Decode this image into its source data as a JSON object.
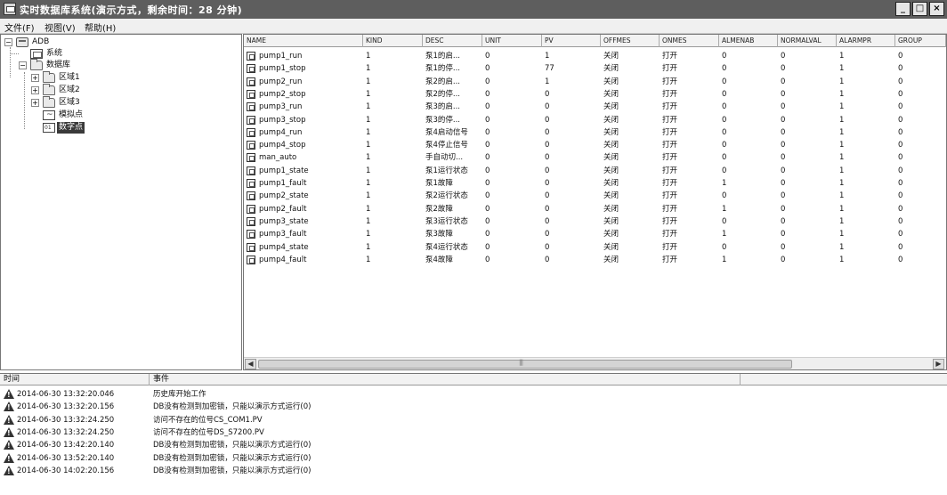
{
  "window": {
    "title": "实时数据库系统(演示方式，剩余时间：28 分钟)",
    "minimize": "_",
    "maximize": "□",
    "close": "×"
  },
  "menu": [
    {
      "label": "文件(F)"
    },
    {
      "label": "视图(V)"
    },
    {
      "label": "帮助(H)"
    }
  ],
  "tree": {
    "expand_symbol": "+",
    "collapse_symbol": "−",
    "nodes": [
      {
        "label": "ADB",
        "icon": "database-icon",
        "expander": "collapse"
      },
      {
        "label": "系统",
        "icon": "system-icon",
        "expander": null
      },
      {
        "label": "数据库",
        "icon": "folder-icon",
        "expander": "collapse"
      },
      {
        "label": "区域1",
        "icon": "folder-icon",
        "expander": "expand"
      },
      {
        "label": "区域2",
        "icon": "folder-icon",
        "expander": "expand"
      },
      {
        "label": "区域3",
        "icon": "folder-icon",
        "expander": "expand"
      },
      {
        "label": "模拟点",
        "icon": "analog-point-icon",
        "expander": null
      },
      {
        "label": "数字点",
        "icon": "digital-point-icon",
        "expander": null,
        "selected": true
      }
    ]
  },
  "grid": {
    "columns": [
      "NAME",
      "KIND",
      "DESC",
      "UNIT",
      "PV",
      "OFFMES",
      "ONMES",
      "ALMENAB",
      "NORMALVAL",
      "ALARMPR",
      "GROUP"
    ],
    "rows": [
      [
        "pump1_run",
        "1",
        "泵1的启...",
        "0",
        "1",
        "关闭",
        "打开",
        "0",
        "0",
        "1",
        "0"
      ],
      [
        "pump1_stop",
        "1",
        "泵1的停...",
        "0",
        "77",
        "关闭",
        "打开",
        "0",
        "0",
        "1",
        "0"
      ],
      [
        "pump2_run",
        "1",
        "泵2的启...",
        "0",
        "1",
        "关闭",
        "打开",
        "0",
        "0",
        "1",
        "0"
      ],
      [
        "pump2_stop",
        "1",
        "泵2的停...",
        "0",
        "0",
        "关闭",
        "打开",
        "0",
        "0",
        "1",
        "0"
      ],
      [
        "pump3_run",
        "1",
        "泵3的启...",
        "0",
        "0",
        "关闭",
        "打开",
        "0",
        "0",
        "1",
        "0"
      ],
      [
        "pump3_stop",
        "1",
        "泵3的停...",
        "0",
        "0",
        "关闭",
        "打开",
        "0",
        "0",
        "1",
        "0"
      ],
      [
        "pump4_run",
        "1",
        "泵4启动信号",
        "0",
        "0",
        "关闭",
        "打开",
        "0",
        "0",
        "1",
        "0"
      ],
      [
        "pump4_stop",
        "1",
        "泵4停止信号",
        "0",
        "0",
        "关闭",
        "打开",
        "0",
        "0",
        "1",
        "0"
      ],
      [
        "man_auto",
        "1",
        "手自动切...",
        "0",
        "0",
        "关闭",
        "打开",
        "0",
        "0",
        "1",
        "0"
      ],
      [
        "pump1_state",
        "1",
        "泵1运行状态",
        "0",
        "0",
        "关闭",
        "打开",
        "0",
        "0",
        "1",
        "0"
      ],
      [
        "pump1_fault",
        "1",
        "泵1故障",
        "0",
        "0",
        "关闭",
        "打开",
        "1",
        "0",
        "1",
        "0"
      ],
      [
        "pump2_state",
        "1",
        "泵2运行状态",
        "0",
        "0",
        "关闭",
        "打开",
        "0",
        "0",
        "1",
        "0"
      ],
      [
        "pump2_fault",
        "1",
        "泵2故障",
        "0",
        "0",
        "关闭",
        "打开",
        "1",
        "0",
        "1",
        "0"
      ],
      [
        "pump3_state",
        "1",
        "泵3运行状态",
        "0",
        "0",
        "关闭",
        "打开",
        "0",
        "0",
        "1",
        "0"
      ],
      [
        "pump3_fault",
        "1",
        "泵3故障",
        "0",
        "0",
        "关闭",
        "打开",
        "1",
        "0",
        "1",
        "0"
      ],
      [
        "pump4_state",
        "1",
        "泵4运行状态",
        "0",
        "0",
        "关闭",
        "打开",
        "0",
        "0",
        "1",
        "0"
      ],
      [
        "pump4_fault",
        "1",
        "泵4故障",
        "0",
        "0",
        "关闭",
        "打开",
        "1",
        "0",
        "1",
        "0"
      ]
    ]
  },
  "scrollbar": {
    "left_arrow": "◀",
    "right_arrow": "▶"
  },
  "log": {
    "columns": [
      "时间",
      "事件"
    ],
    "rows": [
      {
        "time": "2014-06-30 13:32:20.046",
        "event": "历史库开始工作"
      },
      {
        "time": "2014-06-30 13:32:20.156",
        "event": "DB没有检测到加密锁，只能以演示方式运行(0)"
      },
      {
        "time": "2014-06-30 13:32:24.250",
        "event": "访问不存在的位号CS_COM1.PV"
      },
      {
        "time": "2014-06-30 13:32:24.250",
        "event": "访问不存在的位号DS_S7200.PV"
      },
      {
        "time": "2014-06-30 13:42:20.140",
        "event": "DB没有检测到加密锁，只能以演示方式运行(0)"
      },
      {
        "time": "2014-06-30 13:52:20.140",
        "event": "DB没有检测到加密锁，只能以演示方式运行(0)"
      },
      {
        "time": "2014-06-30 14:02:20.156",
        "event": "DB没有检测到加密锁，只能以演示方式运行(0)"
      }
    ]
  }
}
